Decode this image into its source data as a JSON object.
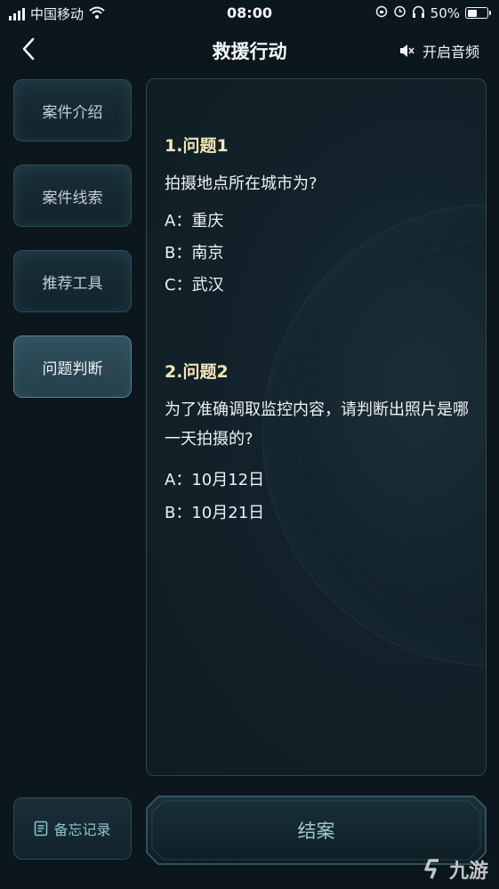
{
  "status_bar": {
    "carrier": "中国移动",
    "time": "08:00",
    "battery": "50%",
    "battery_level": 0.5
  },
  "header": {
    "title": "救援行动",
    "audio_label": "开启音频"
  },
  "sidebar": {
    "items": [
      {
        "label": "案件介绍",
        "active": false
      },
      {
        "label": "案件线索",
        "active": false
      },
      {
        "label": "推荐工具",
        "active": false
      },
      {
        "label": "问题判断",
        "active": true
      }
    ]
  },
  "questions": [
    {
      "title": "1.问题1",
      "text": "拍摄地点所在城市为?",
      "options": [
        "A：重庆",
        "B：南京",
        "C：武汉"
      ]
    },
    {
      "title": "2.问题2",
      "text": "为了准确调取监控内容，请判断出照片是哪一天拍摄的?",
      "options": [
        "A：10月12日",
        "B：10月21日"
      ]
    }
  ],
  "footer": {
    "memo_label": "备忘记录",
    "close_case_label": "结案"
  },
  "watermark": {
    "text": "九游"
  },
  "colors": {
    "background": "#0c161d",
    "question_title": "#f3e6b6",
    "accent": "#8fc0ce"
  }
}
